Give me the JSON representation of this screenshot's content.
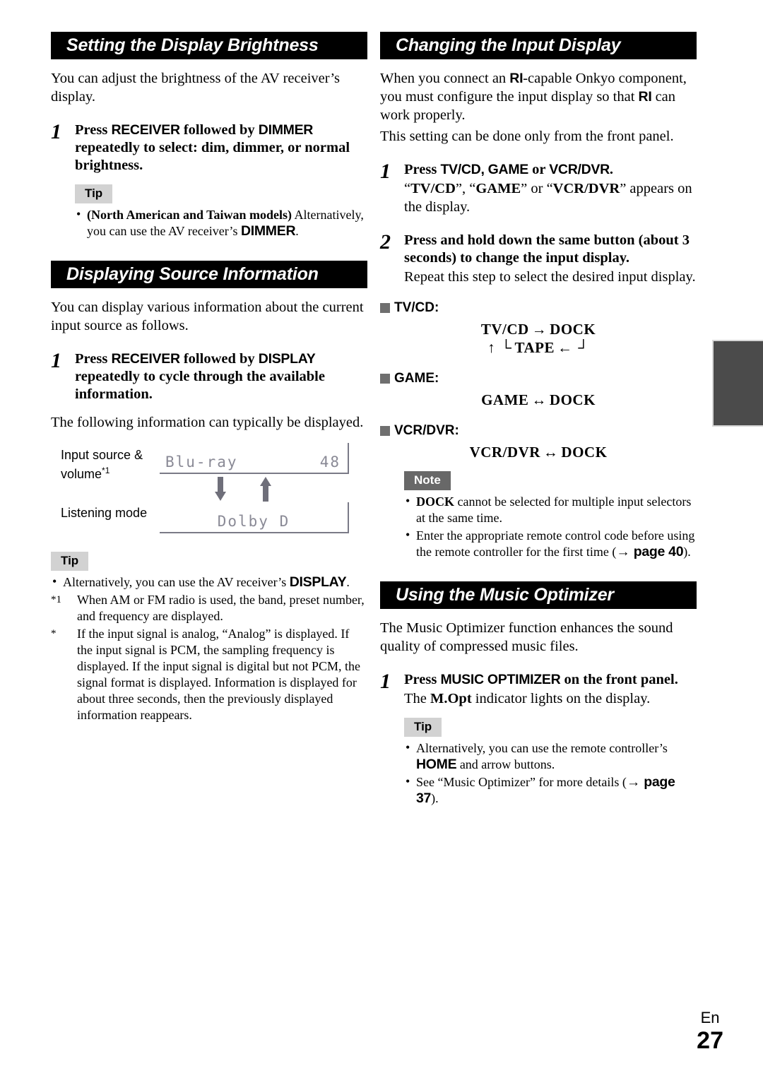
{
  "page": {
    "language_label": "En",
    "page_number": "27"
  },
  "left_column": {
    "section1": {
      "heading": "Setting the Display Brightness",
      "intro": "You can adjust the brightness of the AV receiver’s display.",
      "step": {
        "number": "1",
        "title_parts": {
          "p1": "Press ",
          "b1": "RECEIVER",
          "p2": " followed by ",
          "b2": "DIMMER",
          "p3": " repeatedly to select: dim, dimmer, or normal brightness."
        }
      },
      "tip": {
        "badge": "Tip",
        "bullet1_bold": "(North American and Taiwan models)",
        "bullet1_rest": " Alternatively, you can use the AV receiver’s ",
        "bullet1_key": "DIMMER",
        "bullet1_end": "."
      }
    },
    "section2": {
      "heading": "Displaying Source Information",
      "intro": "You can display various information about the current input source as follows.",
      "step": {
        "number": "1",
        "title_parts": {
          "p1": "Press ",
          "b1": "RECEIVER",
          "p2": " followed by ",
          "b2": "DISPLAY",
          "p3": " repeatedly to cycle through the available information."
        }
      },
      "after_step": "The following information can typically be displayed.",
      "figure": {
        "label_line1": "Input source &",
        "label_line2": "volume",
        "label_sup": "*1",
        "label_listening": "Listening mode",
        "lcd1_left": "Blu-ray",
        "lcd1_right": "48",
        "lcd2_center": "Dolby D",
        "arrow_down": "down-arrow",
        "arrow_up": "up-arrow"
      },
      "tip": {
        "badge": "Tip",
        "bullet1_pre": "Alternatively, you can use the AV receiver’s ",
        "bullet1_key": "DISPLAY",
        "bullet1_end": ".",
        "fn1_mark": "*1",
        "fn1_text": "When AM or FM radio is used, the band, preset number, and frequency are displayed.",
        "fn2_mark": "*",
        "fn2_text": "If the input signal is analog, “Analog” is displayed. If the input signal is PCM, the sampling frequency is displayed. If the input signal is digital but not PCM, the signal format is displayed. Information is displayed for about three seconds, then the previously displayed information reappears."
      }
    }
  },
  "right_column": {
    "section1": {
      "heading": "Changing the Input Display",
      "intro_p1": "When you connect an ",
      "intro_ri1": "RI",
      "intro_p2": "-capable Onkyo component, you must configure the input display so that ",
      "intro_ri2": "RI",
      "intro_p3": " can work properly.",
      "intro_line2": "This setting can be done only from the front panel.",
      "step1": {
        "number": "1",
        "title_p1": "Press ",
        "title_b1": "TV/CD, GAME",
        "title_p2": " or ",
        "title_b2": "VCR/DVR",
        "title_p3": ".",
        "sub_p1": "“",
        "sub_b1": "TV/CD",
        "sub_p2": "”, “",
        "sub_b2": "GAME",
        "sub_p3": "” or “",
        "sub_b3": "VCR/DVR",
        "sub_p4": "” appears on the display."
      },
      "step2": {
        "number": "2",
        "title": "Press and hold down the same button (about 3 seconds) to change the input display.",
        "sub": "Repeat this step to select the desired input display."
      },
      "cycles": [
        {
          "label": "TV/CD:",
          "row1_a": "TV/CD",
          "row1_arrow": "→",
          "row1_b": "DOCK",
          "row2_up": "↑",
          "row2_corner_left": "└",
          "row2_mid": "TAPE",
          "row2_arrow": "←",
          "row2_corner_right": "┘"
        },
        {
          "label": "GAME:",
          "row1_a": "GAME",
          "row1_arrow": "↔",
          "row1_b": "DOCK"
        },
        {
          "label": "VCR/DVR:",
          "row1_a": "VCR/DVR",
          "row1_arrow": "↔",
          "row1_b": "DOCK"
        }
      ],
      "note": {
        "badge": "Note",
        "bullet1_key": "DOCK",
        "bullet1_rest": " cannot be selected for multiple input selectors at the same time.",
        "bullet2_pre": "Enter the appropriate remote control code before using the remote controller for the first time (",
        "bullet2_arrow": "→",
        "bullet2_page": " page 40",
        "bullet2_end": ")."
      }
    },
    "section2": {
      "heading": "Using the Music Optimizer",
      "intro": "The Music Optimizer function enhances the sound quality of compressed music files.",
      "step": {
        "number": "1",
        "title_p1": "Press ",
        "title_b1": "MUSIC OPTIMIZER",
        "title_p2": " on the front panel.",
        "sub_p1": "The ",
        "sub_b1": "M.Opt",
        "sub_p2": " indicator lights on the display."
      },
      "tip": {
        "badge": "Tip",
        "bullet1_pre": "Alternatively, you can use the remote controller’s ",
        "bullet1_key": "HOME",
        "bullet1_rest": " and arrow buttons.",
        "bullet2_pre": "See “Music Optimizer” for more details (",
        "bullet2_arrow": "→",
        "bullet2_page": " page 37",
        "bullet2_end": ")."
      }
    }
  }
}
